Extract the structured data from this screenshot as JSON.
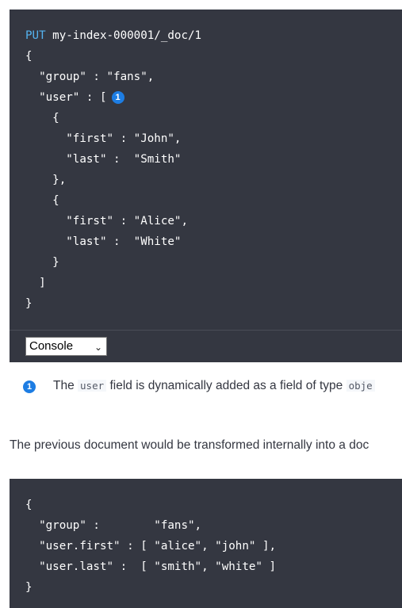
{
  "code_block_1": {
    "method": "PUT",
    "path": "my-index-000001/_doc/1",
    "lines": [
      "{",
      "  \"group\" : \"fans\",",
      "  \"user\" : [",
      "    {",
      "      \"first\" : \"John\",",
      "      \"last\" :  \"Smith\"",
      "    },",
      "    {",
      "      \"first\" : \"Alice\",",
      "      \"last\" :  \"White\"",
      "    }",
      "  ]",
      "}"
    ],
    "callout_number": "1"
  },
  "console": {
    "selected": "Console"
  },
  "callout_note": {
    "number": "1",
    "text_before": "The",
    "code": "user",
    "text_after": "field is dynamically added as a field of type",
    "code_tail": "obje"
  },
  "paragraph": {
    "text": "The previous document would be transformed internally into a doc"
  },
  "code_block_2": {
    "lines": [
      "{",
      "  \"group\" :        \"fans\",",
      "  \"user.first\" : [ \"alice\", \"john\" ],",
      "  \"user.last\" :  [ \"smith\", \"white\" ]",
      "}"
    ]
  },
  "colors": {
    "code_background": "#343741",
    "method": "#54b3f0",
    "callout_badge": "#1d7de3",
    "body_text": "#343741"
  }
}
